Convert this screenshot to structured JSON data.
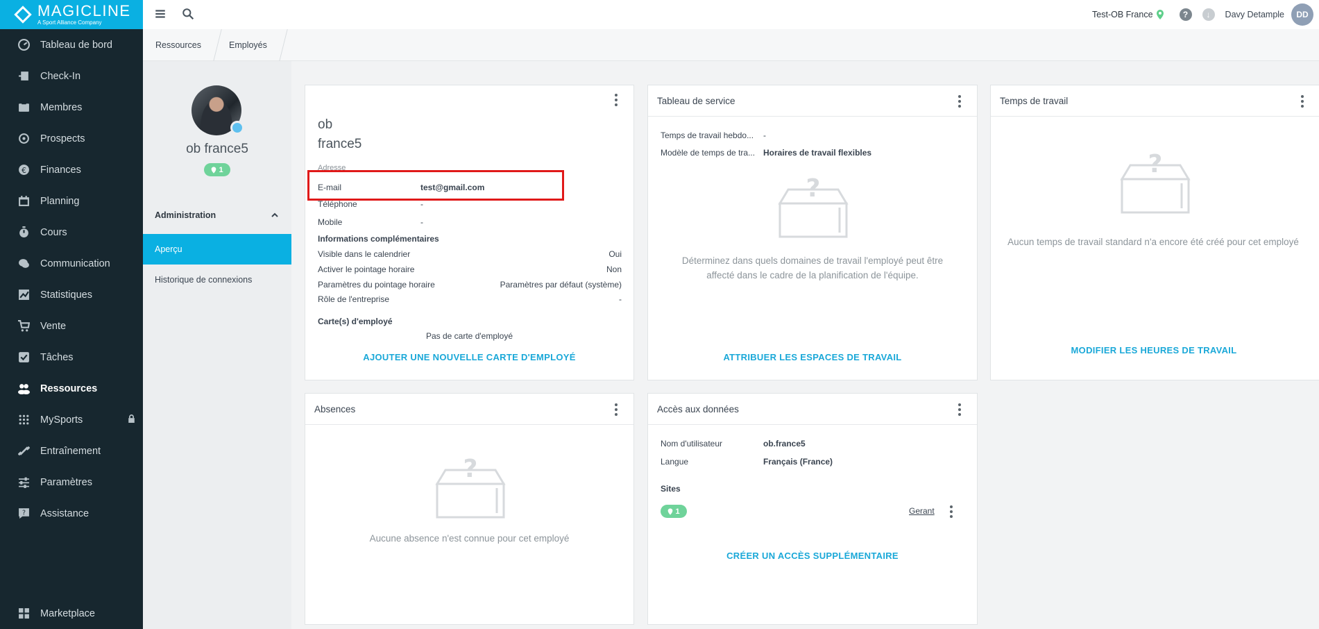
{
  "brand": {
    "name": "MAGICLINE",
    "tagline": "A Sport Alliance Company"
  },
  "sidebar": {
    "items": [
      {
        "label": "Tableau de bord",
        "icon": "dashboard-icon"
      },
      {
        "label": "Check-In",
        "icon": "check-in-icon"
      },
      {
        "label": "Membres",
        "icon": "members-icon"
      },
      {
        "label": "Prospects",
        "icon": "prospects-icon"
      },
      {
        "label": "Finances",
        "icon": "euro-icon"
      },
      {
        "label": "Planning",
        "icon": "calendar-icon"
      },
      {
        "label": "Cours",
        "icon": "timer-icon"
      },
      {
        "label": "Communication",
        "icon": "chat-icon"
      },
      {
        "label": "Statistiques",
        "icon": "chart-icon"
      },
      {
        "label": "Vente",
        "icon": "cart-icon"
      },
      {
        "label": "Tâches",
        "icon": "checkbox-icon"
      },
      {
        "label": "Ressources",
        "icon": "people-icon",
        "active": true
      },
      {
        "label": "MySports",
        "icon": "mysports-icon",
        "locked": true
      },
      {
        "label": "Entraînement",
        "icon": "dumbbell-icon"
      },
      {
        "label": "Paramètres",
        "icon": "sliders-icon"
      },
      {
        "label": "Assistance",
        "icon": "help-chat-icon"
      }
    ],
    "bottom": {
      "label": "Marketplace",
      "icon": "grid-icon"
    }
  },
  "topbar": {
    "studio": "Test-OB France",
    "user": "Davy Detample",
    "initials": "DD",
    "help": "?"
  },
  "breadcrumb": [
    "Ressources",
    "Employés"
  ],
  "profile": {
    "name": "ob france5",
    "sites_count": "1",
    "section": "Administration",
    "links": [
      "Aperçu",
      "Historique de connexions"
    ]
  },
  "details_card": {
    "first_name": "ob",
    "last_name": "france5",
    "address_label": "Adresse",
    "email_label": "E-mail",
    "email_value": "test@gmail.com",
    "phone_label": "Téléphone",
    "phone_value": "-",
    "mobile_label": "Mobile",
    "mobile_value": "-",
    "extra_title": "Informations complémentaires",
    "extra_rows": [
      {
        "label": "Visible dans le calendrier",
        "value": "Oui"
      },
      {
        "label": "Activer le pointage horaire",
        "value": "Non"
      },
      {
        "label": "Paramètres du pointage horaire",
        "value": "Paramètres par défaut (système)"
      },
      {
        "label": "Rôle de l'entreprise",
        "value": "-"
      }
    ],
    "cards_title": "Carte(s) d'employé",
    "cards_empty": "Pas de carte d'employé",
    "cta": "AJOUTER UNE NOUVELLE CARTE D'EMPLOYÉ"
  },
  "service_card": {
    "title": "Tableau de service",
    "rows": [
      {
        "label": "Temps de travail hebdo...",
        "value": "-"
      },
      {
        "label": "Modèle de temps de tra...",
        "value": "Horaires de travail flexibles"
      }
    ],
    "empty_text": "Déterminez dans quels domaines de travail l'employé peut être affecté dans le cadre de la planification de l'équipe.",
    "cta": "ATTRIBUER LES ESPACES DE TRAVAIL"
  },
  "worktime_card": {
    "title": "Temps de travail",
    "empty_text": "Aucun temps de travail standard n'a encore été créé pour cet employé",
    "cta": "MODIFIER LES HEURES DE TRAVAIL"
  },
  "absences_card": {
    "title": "Absences",
    "empty_text": "Aucune absence n'est connue pour cet employé"
  },
  "access_card": {
    "title": "Accès aux données",
    "rows": [
      {
        "label": "Nom d'utilisateur",
        "value": "ob.france5"
      },
      {
        "label": "Langue",
        "value": "Français (France)"
      }
    ],
    "sites_title": "Sites",
    "sites_count": "1",
    "role": "Gerant",
    "cta": "CRÉER UN ACCÈS SUPPLÉMENTAIRE"
  },
  "colors": {
    "accent": "#0ab0e2",
    "sidebar": "#17272f",
    "badge": "#6fd39a",
    "highlight": "#e01919"
  }
}
